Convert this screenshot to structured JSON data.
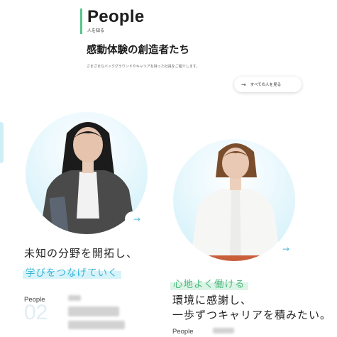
{
  "header": {
    "title": "People",
    "subtitle": "人を知る"
  },
  "headline": "感動体験の創造者たち",
  "lead": "さまざまなバックグラウンドやキャリアを持った社員をご紹介します。",
  "view_all": {
    "label": "すべての人を見る",
    "arrow": "→"
  },
  "cards": [
    {
      "line1": "未知の分野を開拓し、",
      "line2": "学びをつなげていく",
      "people_label": "People",
      "number": "02",
      "more_arrow": "→"
    },
    {
      "line1": "心地よく働ける",
      "line2": "環境に感謝し、",
      "line3": "一歩ずつキャリアを積みたい。",
      "people_label": "People",
      "more_arrow": "→"
    }
  ],
  "colors": {
    "accent_green": "#58c58d",
    "accent_blue": "#36b5d8",
    "circle_bg": "#cdeef8"
  }
}
